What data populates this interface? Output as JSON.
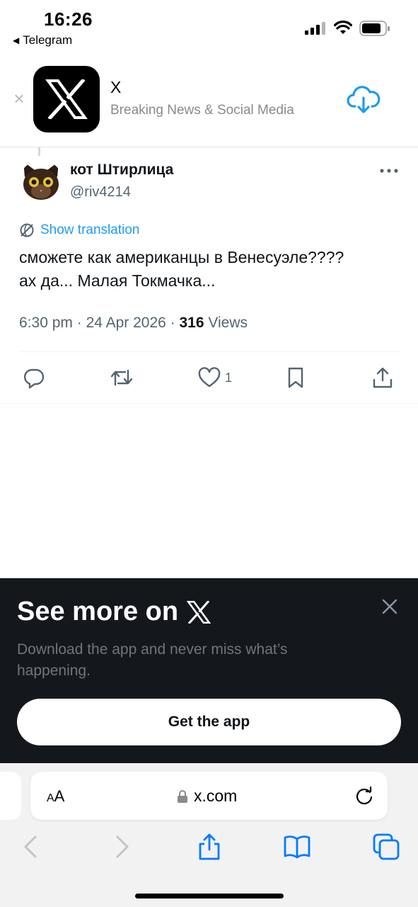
{
  "status_bar": {
    "time": "16:26",
    "back_app": "Telegram",
    "icons": [
      "cellular-signal-icon",
      "wifi-icon",
      "battery-icon"
    ]
  },
  "app_banner": {
    "close_icon": "close-icon",
    "app_name": "X",
    "app_subtitle": "Breaking News & Social Media",
    "download_icon": "cloud-download-icon"
  },
  "tweet": {
    "author_name": "кот Штирлица",
    "author_handle": "@riv4214",
    "translate_label": "Show translation",
    "text_line1": "сможете как американцы в Венесуэле????",
    "text_line2": "ах да... Малая Токмачка...",
    "time": "6:30 pm",
    "date": "24 Apr 2026",
    "views_count": "316",
    "views_label": "Views",
    "likes_count": "1",
    "action_icons": [
      "reply-icon",
      "retweet-icon",
      "like-icon",
      "bookmark-icon",
      "share-icon"
    ]
  },
  "promo": {
    "title": "See more on",
    "text": "Download the app and never miss what’s happening.",
    "button_label": "Get the app"
  },
  "browser": {
    "aa_small": "A",
    "aa_large": "A",
    "url": "x.com",
    "toolbar_icons": [
      "back-icon",
      "forward-icon",
      "share-icon",
      "bookmarks-icon",
      "tabs-icon"
    ]
  },
  "colors": {
    "accent": "#1d9bf0",
    "promo_background": "#14181d",
    "secondary_text": "#536471"
  }
}
